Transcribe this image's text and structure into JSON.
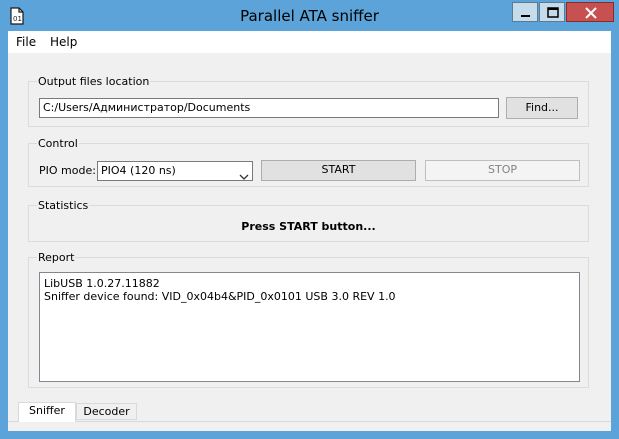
{
  "window": {
    "title": "Parallel ATA sniffer",
    "controls": {
      "minimize": "minimize",
      "maximize": "maximize",
      "close": "close"
    }
  },
  "menu": {
    "items": [
      "File",
      "Help"
    ]
  },
  "output": {
    "legend": "Output files location",
    "path": "C:/Users/Администратор/Documents",
    "find_label": "Find..."
  },
  "control": {
    "legend": "Control",
    "pio_label": "PIO mode:",
    "pio_selected": "PIO4 (120 ns)",
    "start_label": "START",
    "stop_label": "STOP"
  },
  "statistics": {
    "legend": "Statistics",
    "message": "Press START button..."
  },
  "report": {
    "legend": "Report",
    "lines": [
      "LibUSB 1.0.27.11882",
      "Sniffer device found: VID_0x04b4&PID_0x0101 USB 3.0 REV 1.0"
    ]
  },
  "tabs": [
    {
      "label": "Sniffer",
      "active": true
    },
    {
      "label": "Decoder",
      "active": false
    }
  ],
  "colors": {
    "titlebar": "#5ba3d8",
    "close_button": "#c75050"
  }
}
